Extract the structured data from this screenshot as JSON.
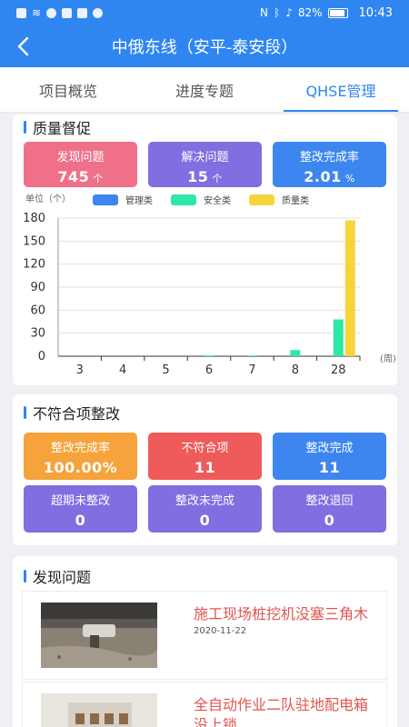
{
  "status_bar": {
    "battery": "82%",
    "time": "10:43"
  },
  "header": {
    "title": "中俄东线（安平-泰安段）"
  },
  "tabs": [
    {
      "label": "项目概览",
      "active": false
    },
    {
      "label": "进度专题",
      "active": false
    },
    {
      "label": "QHSE管理",
      "active": true
    }
  ],
  "quality": {
    "section_title": "质量督促",
    "stats": [
      {
        "label": "发现问题",
        "value": "745",
        "unit": "个",
        "color": "#f0708a"
      },
      {
        "label": "解决问题",
        "value": "15",
        "unit": "个",
        "color": "#7f6fe0"
      },
      {
        "label": "整改完成率",
        "value": "2.01",
        "unit": "%",
        "color": "#3d86ef"
      }
    ],
    "unit_label": "单位（个）",
    "x_unit_label": "(周)"
  },
  "chart_data": {
    "type": "bar",
    "categories": [
      "3",
      "4",
      "5",
      "6",
      "7",
      "8",
      "28"
    ],
    "series": [
      {
        "name": "管理类",
        "color": "#3d86ef",
        "values": [
          0,
          0,
          0,
          0,
          0,
          0,
          0
        ]
      },
      {
        "name": "安全类",
        "color": "#2ee8a8",
        "values": [
          0,
          0,
          0,
          1,
          1,
          8,
          48
        ]
      },
      {
        "name": "质量类",
        "color": "#f5d53a",
        "values": [
          0,
          0,
          0,
          0,
          0,
          0,
          177
        ]
      }
    ],
    "ylim": [
      0,
      180
    ],
    "yticks": [
      0,
      30,
      60,
      90,
      120,
      150,
      180
    ]
  },
  "nonconform": {
    "section_title": "不符合项整改",
    "stats": [
      {
        "label": "整改完成率",
        "value": "100.00%",
        "color": "#f5a33a"
      },
      {
        "label": "不符合项",
        "value": "11",
        "color": "#ef5b5b"
      },
      {
        "label": "整改完成",
        "value": "11",
        "color": "#3d86ef"
      },
      {
        "label": "超期未整改",
        "value": "0",
        "color": "#7f6fe0"
      },
      {
        "label": "整改未完成",
        "value": "0",
        "color": "#7f6fe0"
      },
      {
        "label": "整改退回",
        "value": "0",
        "color": "#7f6fe0"
      }
    ]
  },
  "issues": {
    "section_title": "发现问题",
    "items": [
      {
        "title": "施工现场桩挖机没塞三角木",
        "date": "2020-11-22"
      },
      {
        "title": "全自动作业二队驻地配电箱没上锁",
        "date": ""
      }
    ]
  }
}
